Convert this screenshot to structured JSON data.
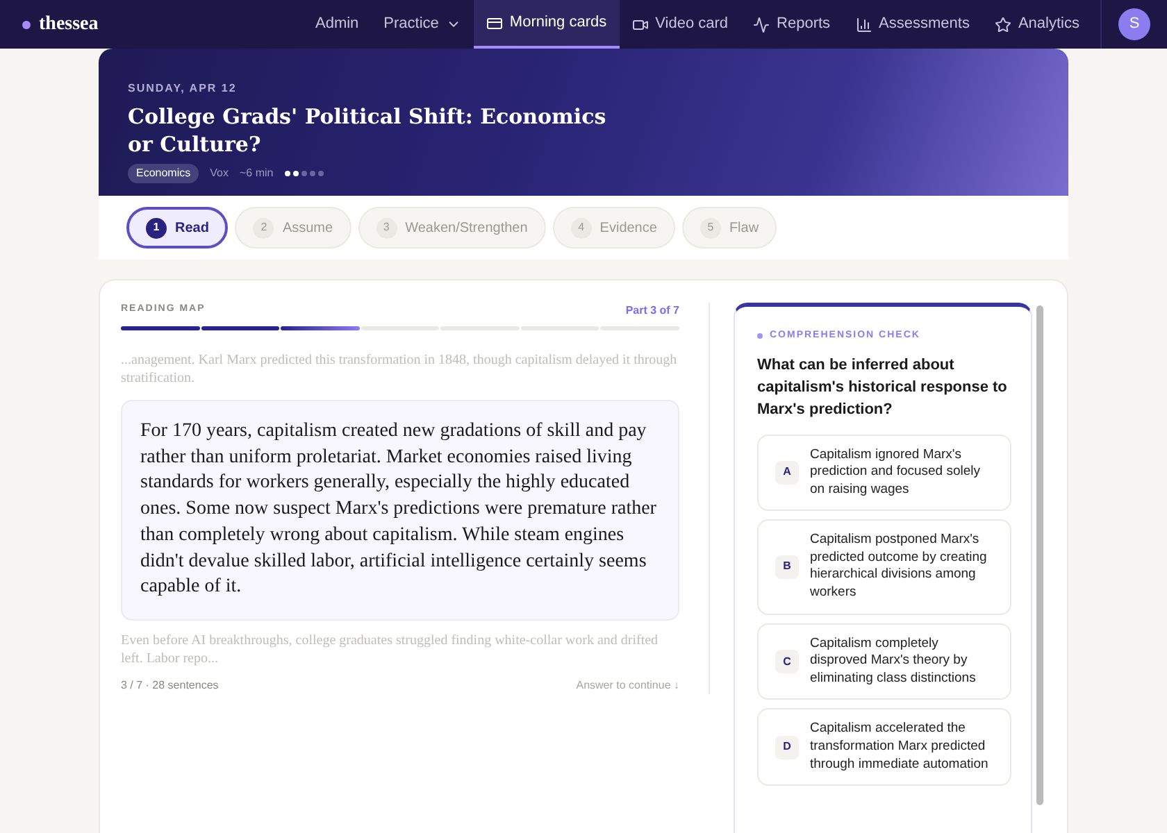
{
  "brand": "thessea",
  "nav": [
    {
      "label": "Admin",
      "kind": "link",
      "selected": false
    },
    {
      "label": "Practice",
      "kind": "menu",
      "selected": false
    },
    {
      "label": "Morning cards",
      "kind": "link",
      "selected": true
    },
    {
      "label": "Video card",
      "kind": "link",
      "selected": false
    },
    {
      "label": "Reports",
      "kind": "link",
      "selected": false
    },
    {
      "label": "Assessments",
      "kind": "link",
      "selected": false
    },
    {
      "label": "Analytics",
      "kind": "link",
      "selected": false
    }
  ],
  "avatar": "S",
  "hero": {
    "date": "SUNDAY, APR 12",
    "title": "College Grads' Political Shift: Economics or Culture?",
    "tag": "Economics",
    "source": "Vox",
    "duration": "~6 min",
    "difficulty": [
      true,
      true,
      false,
      false,
      false
    ]
  },
  "steps": [
    {
      "number": "1",
      "label": "Read",
      "selected": true
    },
    {
      "number": "2",
      "label": "Assume",
      "selected": false
    },
    {
      "number": "3",
      "label": "Weaken/Strengthen",
      "selected": false
    },
    {
      "number": "4",
      "label": "Evidence",
      "selected": false
    },
    {
      "number": "5",
      "label": "Flaw",
      "selected": false
    }
  ],
  "reading": {
    "heading": "READING MAP",
    "part": "Part 3 of 7",
    "segments": [
      {
        "completed": true,
        "selected": false
      },
      {
        "completed": true,
        "selected": false
      },
      {
        "completed": false,
        "selected": true
      },
      {
        "completed": false,
        "selected": false
      },
      {
        "completed": false,
        "selected": false
      },
      {
        "completed": false,
        "selected": false
      },
      {
        "completed": false,
        "selected": false
      }
    ],
    "before": "...anagement. Karl Marx predicted this transformation in 1848, though capitalism delayed it through stratification.",
    "passage": "For 170 years, capitalism created new gradations of skill and pay rather than uniform proletariat. Market economies raised living standards for workers generally, especially the highly educated ones. Some now suspect Marx's predictions were premature rather than completely wrong about capitalism. While steam engines didn't devalue skilled labor, artificial intelligence certainly seems capable of it.",
    "after": "Even before AI breakthroughs, college graduates struggled finding white-collar work and drifted left. Labor repo...",
    "counter": "3 / 7 · 28 sentences",
    "hint": "Answer to continue ↓"
  },
  "check": {
    "label": "COMPREHENSION CHECK",
    "question": "What can be inferred about capitalism's historical response to Marx's prediction?",
    "options": [
      {
        "letter": "A",
        "text": "Capitalism ignored Marx's prediction and focused solely on raising wages",
        "selected": false
      },
      {
        "letter": "B",
        "text": "Capitalism postponed Marx's predicted outcome by creating hierarchical divisions among workers",
        "selected": false
      },
      {
        "letter": "C",
        "text": "Capitalism completely disproved Marx's theory by eliminating class distinctions",
        "selected": false
      },
      {
        "letter": "D",
        "text": "Capitalism accelerated the transformation Marx predicted through immediate automation",
        "selected": false
      }
    ]
  }
}
